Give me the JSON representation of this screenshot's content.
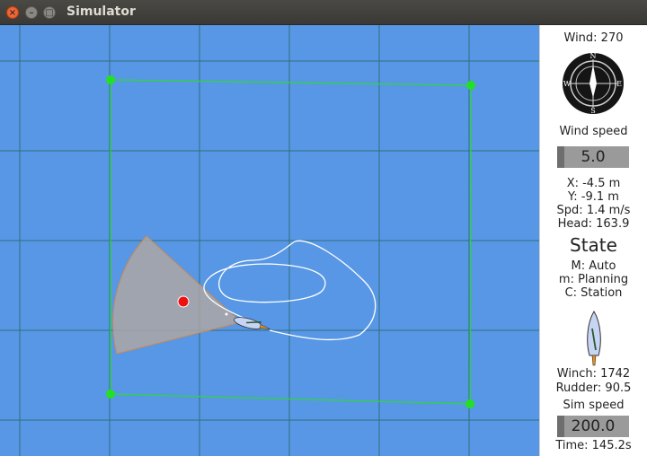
{
  "window": {
    "title": "Simulator",
    "close_glyph": "×",
    "minimize_glyph": "–",
    "maximize_glyph": "□"
  },
  "colors": {
    "water": "#5897e5",
    "grid": "#2f6f7d",
    "boundary": "#2fd63a",
    "waypoint": "#22e022",
    "track": "#ffffff",
    "no_go_sector": "#b5a8a0",
    "target": "#ee1111"
  },
  "icons": {
    "compass": "compass-icon",
    "boat": "boat-icon",
    "target": "target-marker"
  },
  "compass": {
    "north": "N",
    "south": "S",
    "east": "E",
    "west": "W"
  },
  "panel": {
    "wind": "Wind: 270",
    "wind_speed_label": "Wind speed",
    "wind_speed_value": "5.0",
    "x": "X: -4.5 m",
    "y": "Y: -9.1 m",
    "speed": "Spd: 1.4 m/s",
    "heading": "Head: 163.9",
    "state_title": "State",
    "mode": "M: Auto",
    "sub_mode": "m: Planning",
    "control": "C: Station",
    "winch": "Winch: 1742",
    "rudder": "Rudder: 90.5",
    "sim_speed_label": "Sim speed",
    "sim_speed_value": "200.0",
    "time": "Time: 145.2s"
  }
}
